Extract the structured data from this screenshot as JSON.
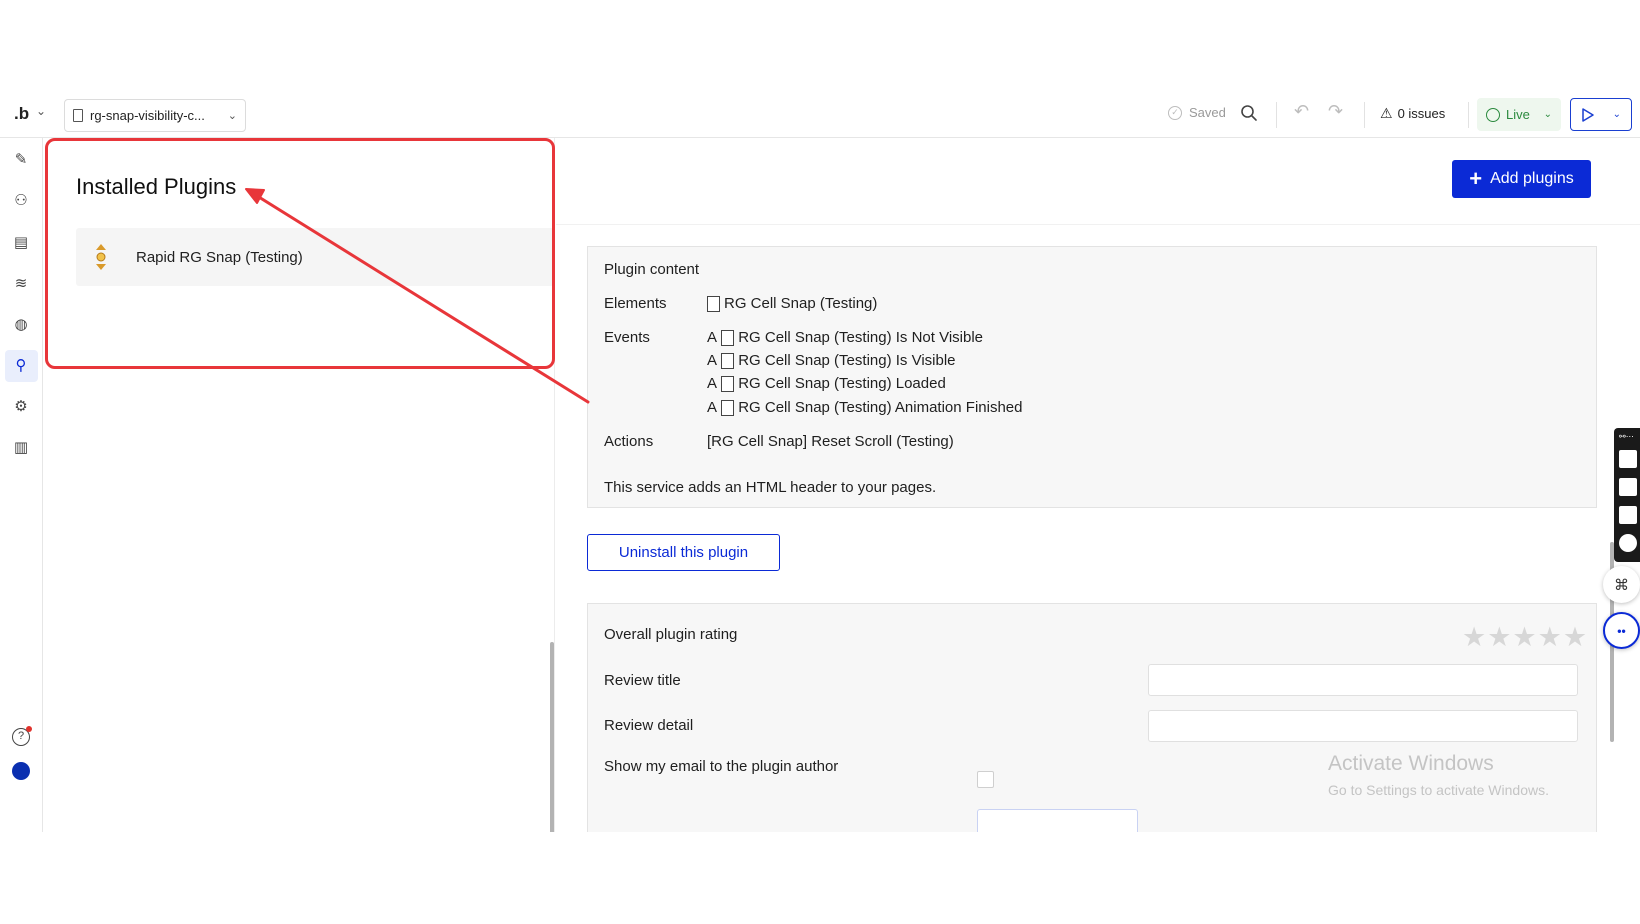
{
  "topbar": {
    "logo": ".b",
    "page_name": "rg-snap-visibility-c...",
    "saved_label": "Saved",
    "issues_label": "0 issues",
    "live_label": "Live"
  },
  "plugins_panel": {
    "title": "Installed Plugins",
    "items": [
      {
        "name": "Rapid RG Snap (Testing)"
      }
    ]
  },
  "content": {
    "add_button": "Add plugins",
    "plugin_content": {
      "heading": "Plugin content",
      "elements_label": "Elements",
      "elements": [
        "RG Cell Snap (Testing)"
      ],
      "events_label": "Events",
      "events": [
        {
          "prefix": "A",
          "text": "RG Cell Snap (Testing) Is Not Visible"
        },
        {
          "prefix": "A",
          "text": "RG Cell Snap (Testing) Is Visible"
        },
        {
          "prefix": "A",
          "text": "RG Cell Snap (Testing) Loaded"
        },
        {
          "prefix": "A",
          "text": "RG Cell Snap (Testing) Animation Finished"
        }
      ],
      "actions_label": "Actions",
      "actions": [
        "[RG Cell Snap] Reset Scroll (Testing)"
      ],
      "note": "This service adds an HTML header to your pages."
    },
    "uninstall_button": "Uninstall this plugin",
    "review": {
      "rating_label": "Overall plugin rating",
      "rating_value": 0,
      "rating_max": 5,
      "stars": "★★★★★",
      "title_label": "Review title",
      "title_value": "",
      "detail_label": "Review detail",
      "detail_value": "",
      "email_label": "Show my email to the plugin author",
      "email_checked": false
    },
    "watermark": {
      "line1": "Activate Windows",
      "line2": "Go to Settings to activate Windows."
    }
  },
  "colors": {
    "accent": "#0b2ad6",
    "annotation": "#e8363a",
    "live_green": "#2b8a3e"
  }
}
